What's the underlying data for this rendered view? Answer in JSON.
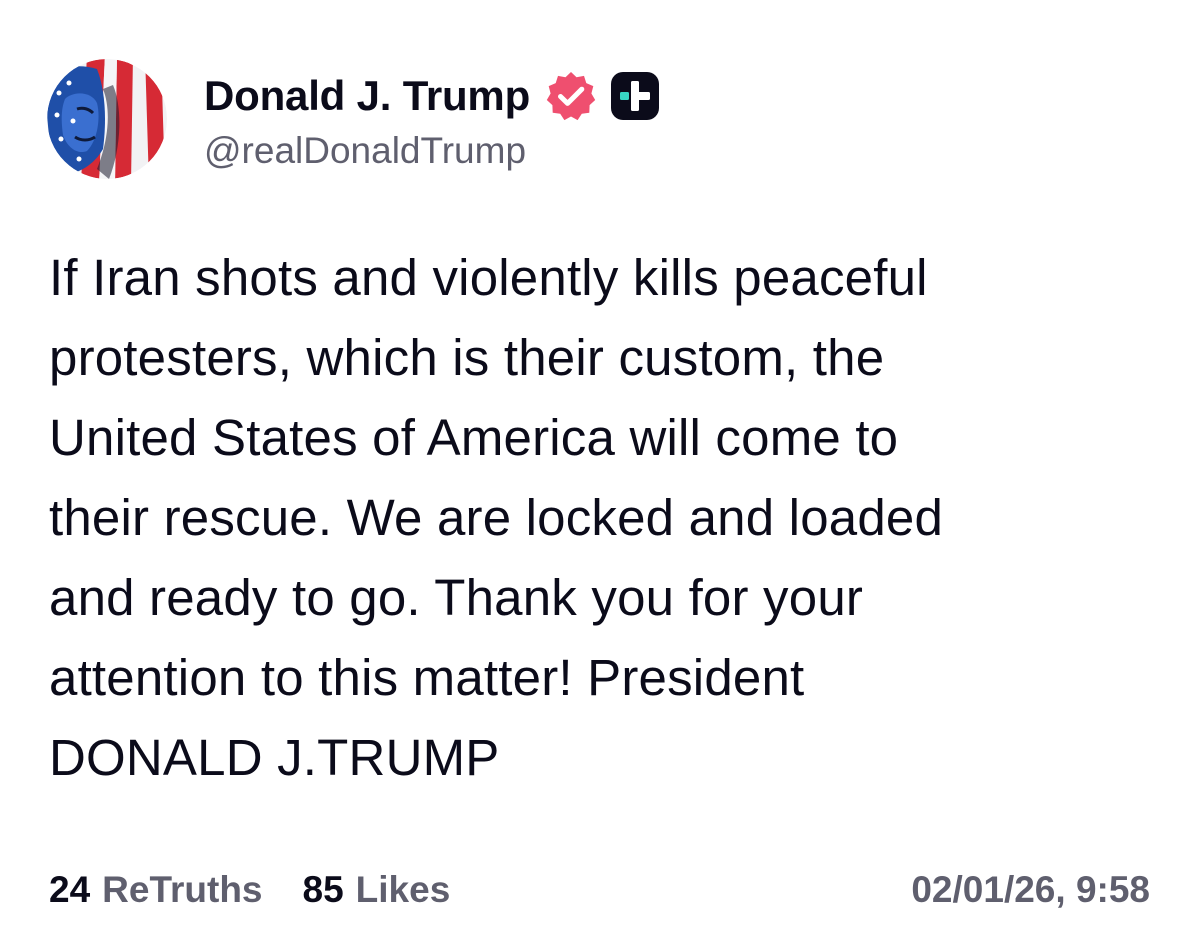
{
  "account": {
    "display_name": "Donald J. Trump",
    "handle": "@realDonaldTrump",
    "verified_icon": "verified-badge-icon",
    "plus_icon": "plus-badge-icon",
    "colors": {
      "verified": "#ef4f6f",
      "plus_badge_bg": "#0b0b1a",
      "plus_badge_accent": "#38d6c4"
    }
  },
  "post": {
    "text": "If Iran shots and violently kills peaceful\nprotesters, which is their custom, the\nUnited States of America will come to\ntheir rescue. We are locked and loaded\nand ready to go. Thank you for your\nattention to this matter! President\nDONALD J.TRUMP"
  },
  "stats": {
    "retruths_count": "24",
    "retruths_label": "ReTruths",
    "likes_count": "85",
    "likes_label": "Likes",
    "timestamp": "02/01/26, 9:58"
  }
}
